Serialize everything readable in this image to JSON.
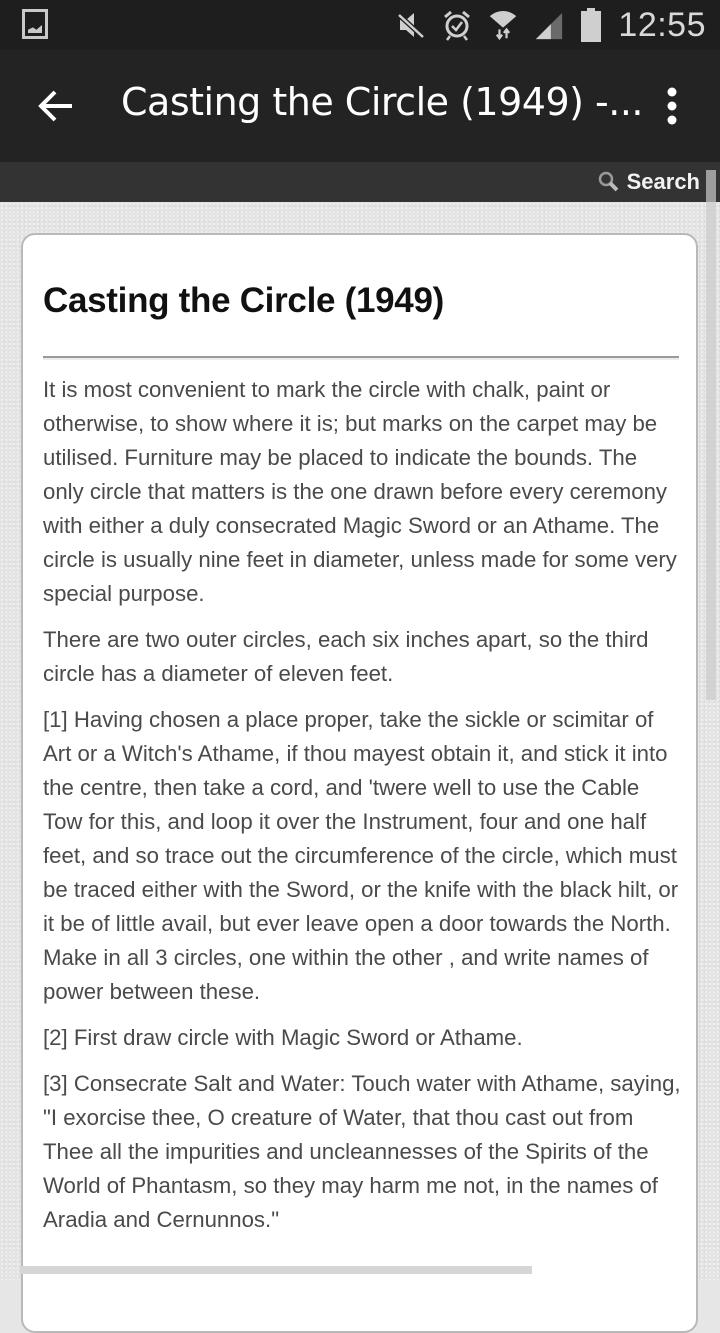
{
  "status_bar": {
    "time": "12:55",
    "icons": [
      "gallery-notification-icon",
      "mute-icon",
      "alarm-icon",
      "wifi-icon",
      "signal-icon",
      "battery-icon"
    ]
  },
  "app_bar": {
    "back_icon": "arrow-left-icon",
    "title": "Casting the Circle (1949) -...",
    "overflow_icon": "more-vert-icon"
  },
  "search": {
    "label": "Search",
    "icon": "search-icon"
  },
  "article": {
    "heading": "Casting the Circle (1949)",
    "paragraphs": [
      "It is most convenient to mark the circle with chalk, paint or otherwise, to show where it is; but marks on the carpet may be utilised. Furniture may be placed to indicate the bounds. The only circle that matters is the one drawn before every ceremony with either a duly consecrated Magic Sword or an Athame. The circle is usually nine feet in diameter, unless made for some very special purpose.",
      "There are two outer circles, each six inches apart, so the third circle has a diameter of eleven feet.",
      "[1] Having chosen a place proper, take the sickle or scimitar of Art or a Witch's Athame, if thou mayest obtain it, and stick it into the centre, then take a cord, and 'twere well to use the Cable Tow for this, and loop it over the Instrument, four and one half feet, and so trace out the circumference of the circle, which must be traced either with the Sword, or the knife with the black hilt, or it be of little avail, but ever leave open a door towards the North. Make in all 3 circles, one within the other , and write names of power between these.",
      "[2] First draw circle with Magic Sword or Athame.",
      "[3] Consecrate Salt and Water: Touch water with Athame, saying, \"I exorcise thee, O creature of Water, that thou cast out from Thee all the impurities and uncleannesses of the Spirits of the World of Phantasm, so they may harm me not, in the names of Aradia and Cernunnos.\""
    ]
  }
}
